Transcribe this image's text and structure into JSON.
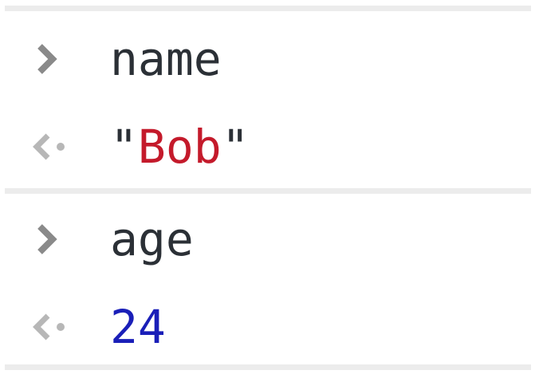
{
  "console": {
    "entries": [
      {
        "input": {
          "prompt_icon": "chevron-right-icon",
          "text": "name"
        },
        "output": {
          "result_icon": "return-arrow-icon",
          "type": "string",
          "quote": "\"",
          "value": "Bob"
        }
      },
      {
        "input": {
          "prompt_icon": "chevron-right-icon",
          "text": "age"
        },
        "output": {
          "result_icon": "return-arrow-icon",
          "type": "number",
          "value": "24"
        }
      }
    ]
  },
  "colors": {
    "text": "#2b3036",
    "string": "#c41a2b",
    "number": "#1a1fb8",
    "icon": "#8a8a8a",
    "divider": "#ececec"
  }
}
